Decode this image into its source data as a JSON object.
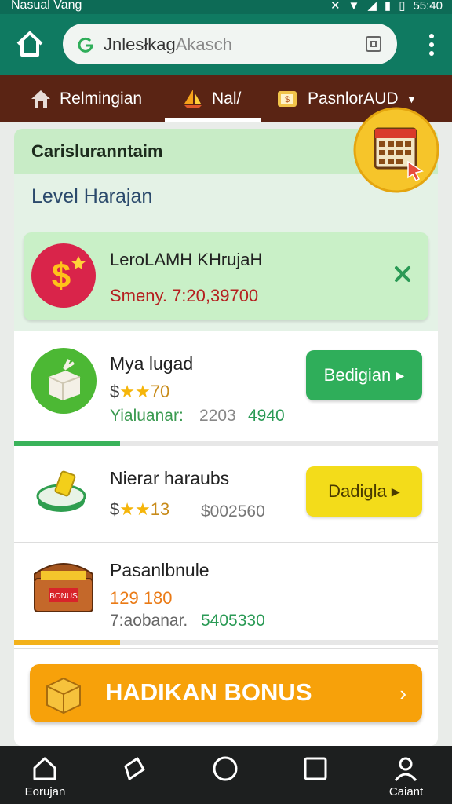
{
  "status_bar": {
    "carrier": "Nasual Vang",
    "time": "55:40"
  },
  "browser": {
    "url_main": "Jnlesłkag",
    "url_dim": "Akasch"
  },
  "nav": {
    "items": [
      {
        "label": "Relmingian",
        "icon": "house-icon"
      },
      {
        "label": "Nal/",
        "icon": "sailboat-icon"
      },
      {
        "label": "PasnlorAUD",
        "icon": "wallet-icon"
      }
    ]
  },
  "card": {
    "header_title": "Carisluranntaim",
    "level_title": "Level Harajan",
    "level_box": {
      "name": "LeroLAMH KHrujaH",
      "money": "Smeny. 7:20,39700"
    },
    "rows": [
      {
        "title": "Mya lugad",
        "price_prefix": "$",
        "price_value": "70",
        "stats_label": "Yialuanar:",
        "stats_value_a": "2203",
        "stats_value_b": "4940",
        "button": "Bedigian",
        "progress": 0.25
      },
      {
        "title": "Nierar haraubs",
        "price_prefix": "$",
        "price_value": "13",
        "amount": "$002560",
        "button": "Dadigla"
      },
      {
        "title": "Pasanlbnule",
        "orange_value": "129 180",
        "stats_label": "7:aobanar.",
        "stats_value": "5405330",
        "progress": 0.25
      }
    ],
    "bonus_label": "HADIKAN BONUS"
  },
  "bottom_nav": [
    {
      "label": "Eorujan",
      "icon": "home-icon"
    },
    {
      "label": "",
      "icon": "back-icon"
    },
    {
      "label": "",
      "icon": "circle-home-icon"
    },
    {
      "label": "",
      "icon": "square-recents-icon"
    },
    {
      "label": "Caiant",
      "icon": "person-icon"
    }
  ],
  "colors": {
    "brand_green": "#0f7a61",
    "nav_brown": "#5a2414",
    "accent_orange": "#f7a10a",
    "button_green": "#2fae5a",
    "button_yellow": "#f3dc1a"
  }
}
